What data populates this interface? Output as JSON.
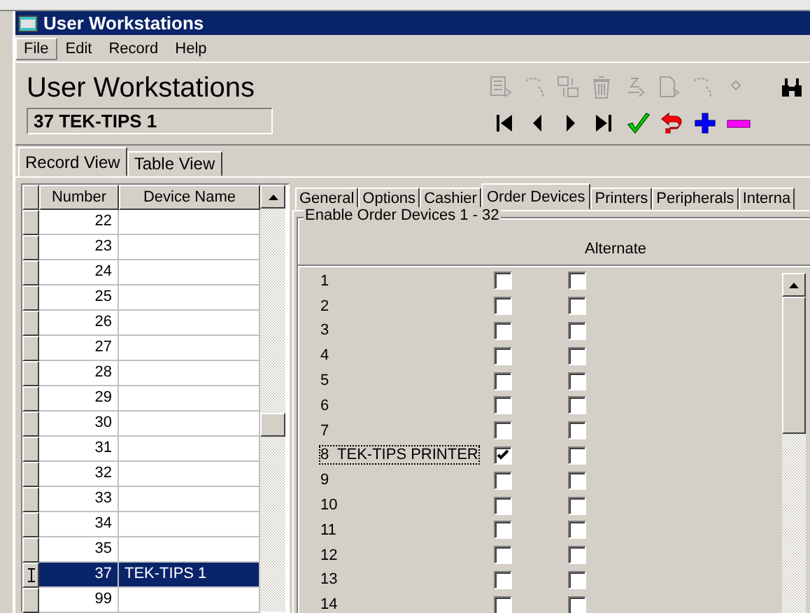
{
  "window": {
    "title": "User Workstations"
  },
  "menu": [
    {
      "label": "File",
      "selected": true
    },
    {
      "label": "Edit",
      "selected": false
    },
    {
      "label": "Record",
      "selected": false
    },
    {
      "label": "Help",
      "selected": false
    }
  ],
  "header": {
    "title": "User Workstations",
    "record": "37 TEK-TIPS 1"
  },
  "toolbar": [
    {
      "kind": "copy",
      "disabled": true
    },
    {
      "kind": "link",
      "disabled": true
    },
    {
      "kind": "swap",
      "disabled": true
    },
    {
      "kind": "delete",
      "disabled": true
    },
    {
      "kind": "sort",
      "disabled": true
    },
    {
      "kind": "paste",
      "disabled": true
    },
    {
      "kind": "link",
      "disabled": true
    },
    {
      "kind": "small",
      "disabled": true
    },
    {
      "kind": "find",
      "disabled": false
    }
  ],
  "navigation": [
    {
      "kind": "first"
    },
    {
      "kind": "prev"
    },
    {
      "kind": "next"
    },
    {
      "kind": "last"
    },
    {
      "kind": "save"
    },
    {
      "kind": "undo"
    },
    {
      "kind": "add"
    },
    {
      "kind": "remove"
    }
  ],
  "view_tabs": [
    {
      "label": "Record View",
      "selected": true
    },
    {
      "label": "Table View",
      "selected": false
    }
  ],
  "table": {
    "columns": [
      "Number",
      "Device Name"
    ],
    "rows": [
      {
        "number": "22",
        "name": "",
        "selected": false
      },
      {
        "number": "23",
        "name": "",
        "selected": false
      },
      {
        "number": "24",
        "name": "",
        "selected": false
      },
      {
        "number": "25",
        "name": "",
        "selected": false
      },
      {
        "number": "26",
        "name": "",
        "selected": false
      },
      {
        "number": "27",
        "name": "",
        "selected": false
      },
      {
        "number": "28",
        "name": "",
        "selected": false
      },
      {
        "number": "29",
        "name": "",
        "selected": false
      },
      {
        "number": "30",
        "name": "",
        "selected": false
      },
      {
        "number": "31",
        "name": "",
        "selected": false
      },
      {
        "number": "32",
        "name": "",
        "selected": false
      },
      {
        "number": "33",
        "name": "",
        "selected": false
      },
      {
        "number": "34",
        "name": "",
        "selected": false
      },
      {
        "number": "35",
        "name": "",
        "selected": false
      },
      {
        "number": "37",
        "name": "TEK-TIPS 1",
        "selected": true
      },
      {
        "number": "99",
        "name": "",
        "selected": false
      }
    ]
  },
  "detail_tabs": [
    {
      "label": "General",
      "selected": false
    },
    {
      "label": "Options",
      "selected": false
    },
    {
      "label": "Cashier",
      "selected": false
    },
    {
      "label": "Order Devices",
      "selected": true
    },
    {
      "label": "Printers",
      "selected": false
    },
    {
      "label": "Peripherals",
      "selected": false
    },
    {
      "label": "Interna",
      "selected": false
    }
  ],
  "order_devices": {
    "title": "Enable Order Devices 1 - 32",
    "alternate_header": "Alternate",
    "items": [
      {
        "label": "1",
        "enabled": false,
        "alternate": false,
        "focused": false
      },
      {
        "label": "2",
        "enabled": false,
        "alternate": false,
        "focused": false
      },
      {
        "label": "3",
        "enabled": false,
        "alternate": false,
        "focused": false
      },
      {
        "label": "4",
        "enabled": false,
        "alternate": false,
        "focused": false
      },
      {
        "label": "5",
        "enabled": false,
        "alternate": false,
        "focused": false
      },
      {
        "label": "6",
        "enabled": false,
        "alternate": false,
        "focused": false
      },
      {
        "label": "7",
        "enabled": false,
        "alternate": false,
        "focused": false
      },
      {
        "label": "8  TEK-TIPS PRINTER",
        "enabled": true,
        "alternate": false,
        "focused": true
      },
      {
        "label": "9",
        "enabled": false,
        "alternate": false,
        "focused": false
      },
      {
        "label": "10",
        "enabled": false,
        "alternate": false,
        "focused": false
      },
      {
        "label": "11",
        "enabled": false,
        "alternate": false,
        "focused": false
      },
      {
        "label": "12",
        "enabled": false,
        "alternate": false,
        "focused": false
      },
      {
        "label": "13",
        "enabled": false,
        "alternate": false,
        "focused": false
      },
      {
        "label": "14",
        "enabled": false,
        "alternate": false,
        "focused": false
      }
    ]
  }
}
